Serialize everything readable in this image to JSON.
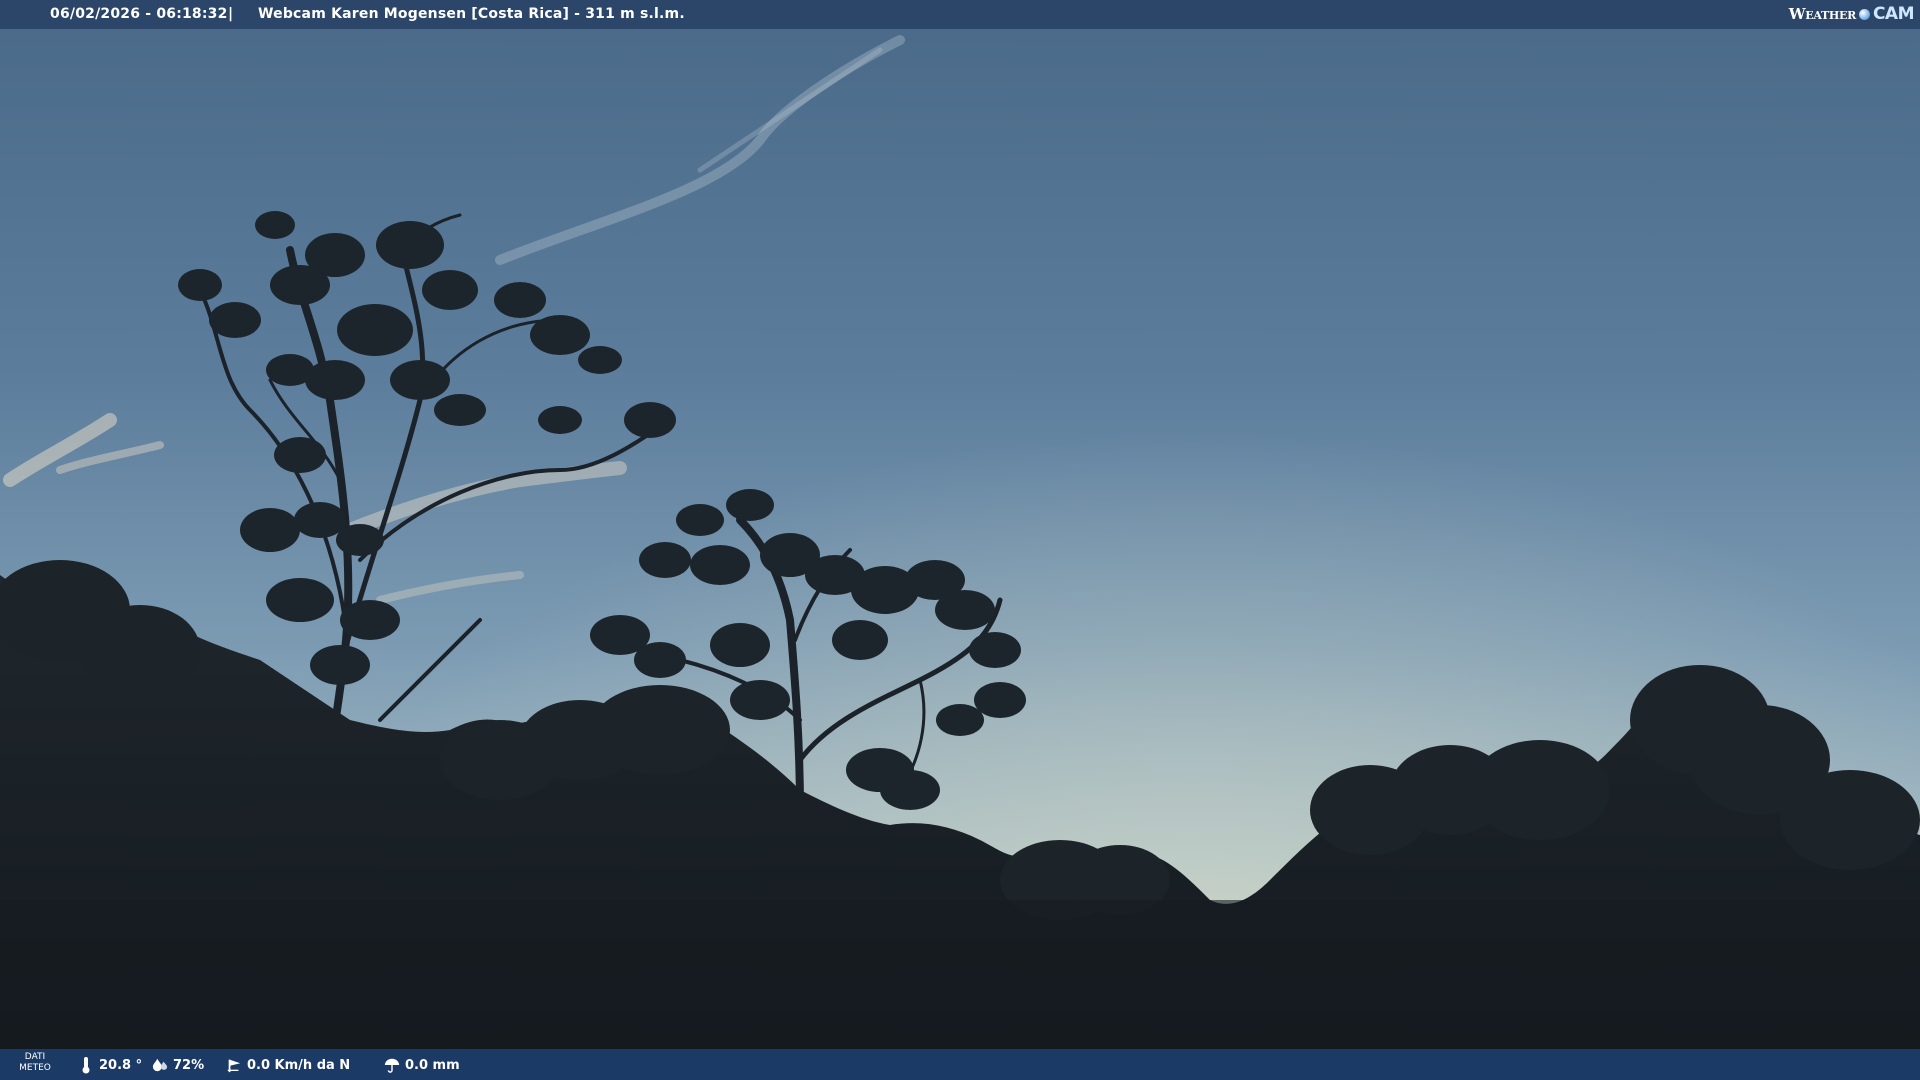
{
  "header": {
    "datetime": "06/02/2026 - 06:18:32",
    "separator": "|",
    "title": "Webcam Karen Mogensen [Costa Rica] - 311 m s.l.m."
  },
  "brand": {
    "part1": "Weather",
    "part2": "CAM"
  },
  "weather": {
    "label_line1": "DATI",
    "label_line2": "METEO",
    "temperature": "20.8 °",
    "humidity": "72%",
    "wind": "0.0 Km/h da N",
    "rain": "0.0 mm"
  },
  "icons": {
    "temperature": "thermometer-icon",
    "humidity": "humidity-drops-icon",
    "wind": "wind-vane-icon",
    "rain": "rain-umbrella-icon"
  },
  "colors": {
    "sky_top": "#4c6a8a",
    "sky_horizon": "#b3c3c2",
    "forest": "#1a2026",
    "bar_top": "#2b4668",
    "bar_bottom": "#1b3a66"
  }
}
